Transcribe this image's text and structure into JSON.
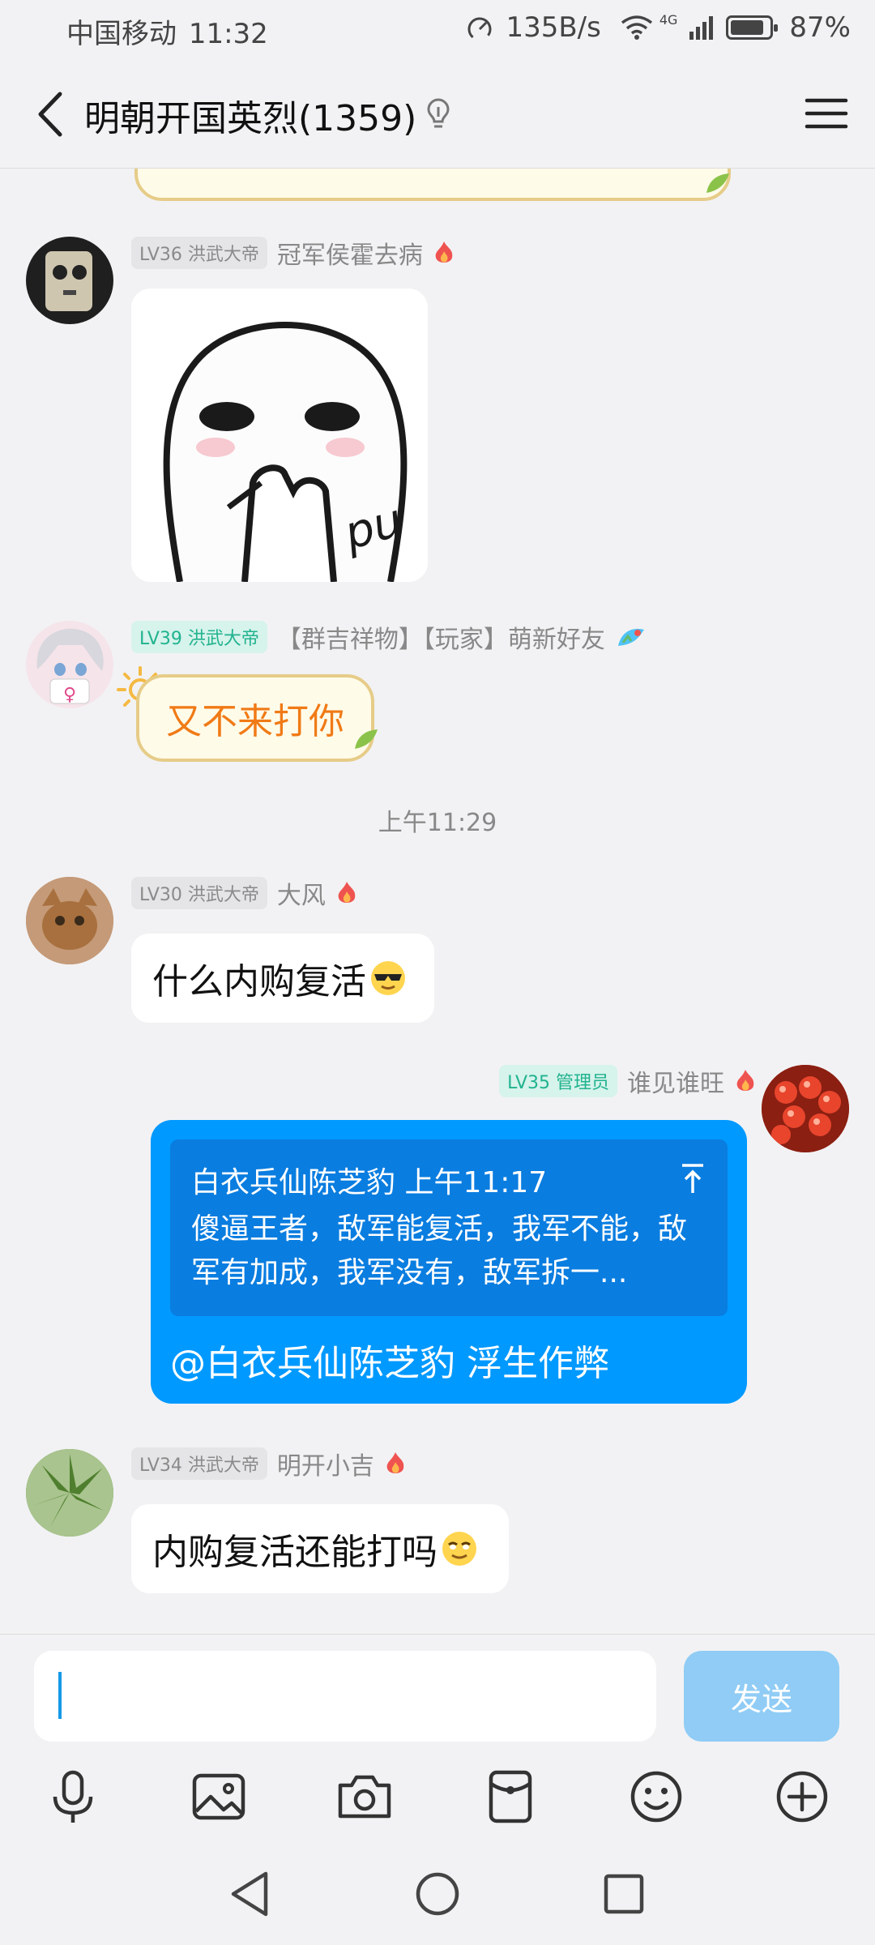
{
  "status_bar": {
    "carrier": "中国移动",
    "time": "11:32",
    "speed": "135B/s",
    "network": "4G",
    "battery": "87%"
  },
  "title_bar": {
    "title": "明朝开国英烈(1359)"
  },
  "messages": [
    {
      "level": "LV36 洪武大帝",
      "sender": "冠军侯霍去病",
      "type": "sticker",
      "sticker_text": "pu"
    },
    {
      "level": "LV39 洪武大帝",
      "sender": "【群吉祥物】【玩家】萌新好友",
      "type": "fancy-bubble",
      "text": "又不来打你"
    },
    {
      "type": "time",
      "text": "上午11:29"
    },
    {
      "level": "LV30 洪武大帝",
      "sender": "大风",
      "type": "text",
      "text": "什么内购复活"
    },
    {
      "level": "LV35 管理员",
      "sender": "谁见谁旺",
      "type": "reply",
      "quote_header": "白衣兵仙陈芝豹 上午11:17",
      "quote_text": "傻逼王者，敌军能复活，我军不能，敌军有加成，我军没有，敌军拆一...",
      "text": "@白衣兵仙陈芝豹 浮生作弊"
    },
    {
      "level": "LV34 洪武大帝",
      "sender": "明开小吉",
      "type": "text",
      "text": "内购复活还能打吗"
    }
  ],
  "input_bar": {
    "send_label": "发送",
    "tools": [
      "microphone-icon",
      "image-icon",
      "camera-icon",
      "red-packet-icon",
      "emoji-icon",
      "plus-icon"
    ]
  },
  "colors": {
    "accent": "#0099ff",
    "send_disabled": "#90ccf5",
    "background": "#f2f2f4",
    "fancy_text": "#f07a16"
  }
}
